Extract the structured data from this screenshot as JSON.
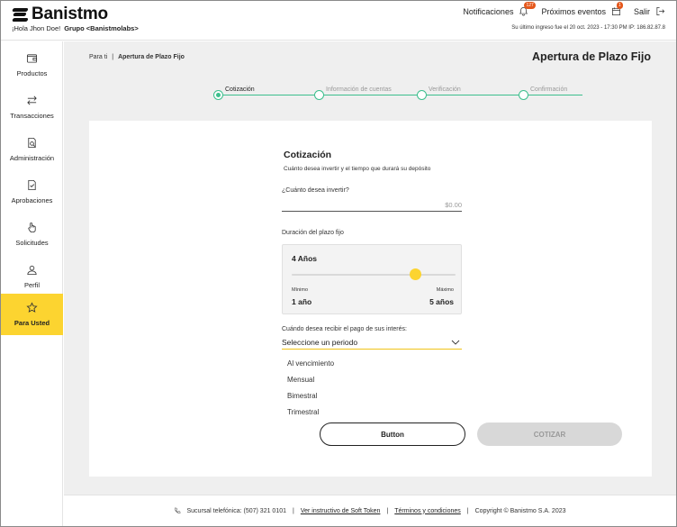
{
  "header": {
    "brand": "Banistmo",
    "greeting": "¡Hola Jhon Doe!",
    "group": "Grupo <Banistmolabs>",
    "notifications_label": "Notificaciones",
    "notifications_count": "127",
    "events_label": "Próximos eventos",
    "events_count": "1",
    "logout_label": "Salir",
    "last_login": "Su último ingreso fue el 20 oct. 2023 - 17:30 PM IP: 186.82.87.8"
  },
  "sidebar": {
    "items": [
      {
        "label": "Productos",
        "icon": "wallet-icon"
      },
      {
        "label": "Transacciones",
        "icon": "transfer-arrows-icon"
      },
      {
        "label": "Administración",
        "icon": "document-search-icon"
      },
      {
        "label": "Aprobaciones",
        "icon": "document-check-icon"
      },
      {
        "label": "Solicitudes",
        "icon": "hand-pointer-icon"
      },
      {
        "label": "Perfil",
        "icon": "user-icon"
      },
      {
        "label": "Para Usted",
        "icon": "star-icon",
        "active": true
      }
    ]
  },
  "breadcrumb": {
    "root": "Para ti",
    "separator": "|",
    "current": "Apertura de Plazo Fijo"
  },
  "page_title": "Apertura de Plazo Fijo",
  "stepper": {
    "steps": [
      {
        "label": "Cotización",
        "active": true
      },
      {
        "label": "Información de cuentas",
        "active": false
      },
      {
        "label": "Verificación",
        "active": false
      },
      {
        "label": "Confirmación",
        "active": false
      }
    ]
  },
  "form": {
    "title": "Cotización",
    "subtitle": "Cuánto desea invertir y el tiempo que durará su depósito",
    "amount_label": "¿Cuánto desea invertir?",
    "amount_placeholder": "$0.00",
    "duration_label": "Duración del plazo fijo",
    "duration_value": "4 Años",
    "slider_fraction": 0.75,
    "min_label": "Mínimo",
    "max_label": "Máximo",
    "min_value": "1 año",
    "max_value": "5 años",
    "period_label": "Cuándo desea recibir el pago de sus interés:",
    "period_selected": "Seleccione un periodo",
    "period_options": [
      "Al vencimiento",
      "Mensual",
      "Bimestral",
      "Trimestral"
    ]
  },
  "buttons": {
    "secondary": "Button",
    "primary": "COTIZAR"
  },
  "footer": {
    "phone": "Sucursal telefónica: (507) 321 0101",
    "soft_token": "Ver instructivo de Soft Token",
    "terms": "Términos y condiciones",
    "copyright": "Copyright © Banistmo S.A. 2023"
  },
  "colors": {
    "accent_yellow": "#fcd430",
    "stepper_green": "#3cbf8d",
    "badge_orange": "#e5571b"
  }
}
